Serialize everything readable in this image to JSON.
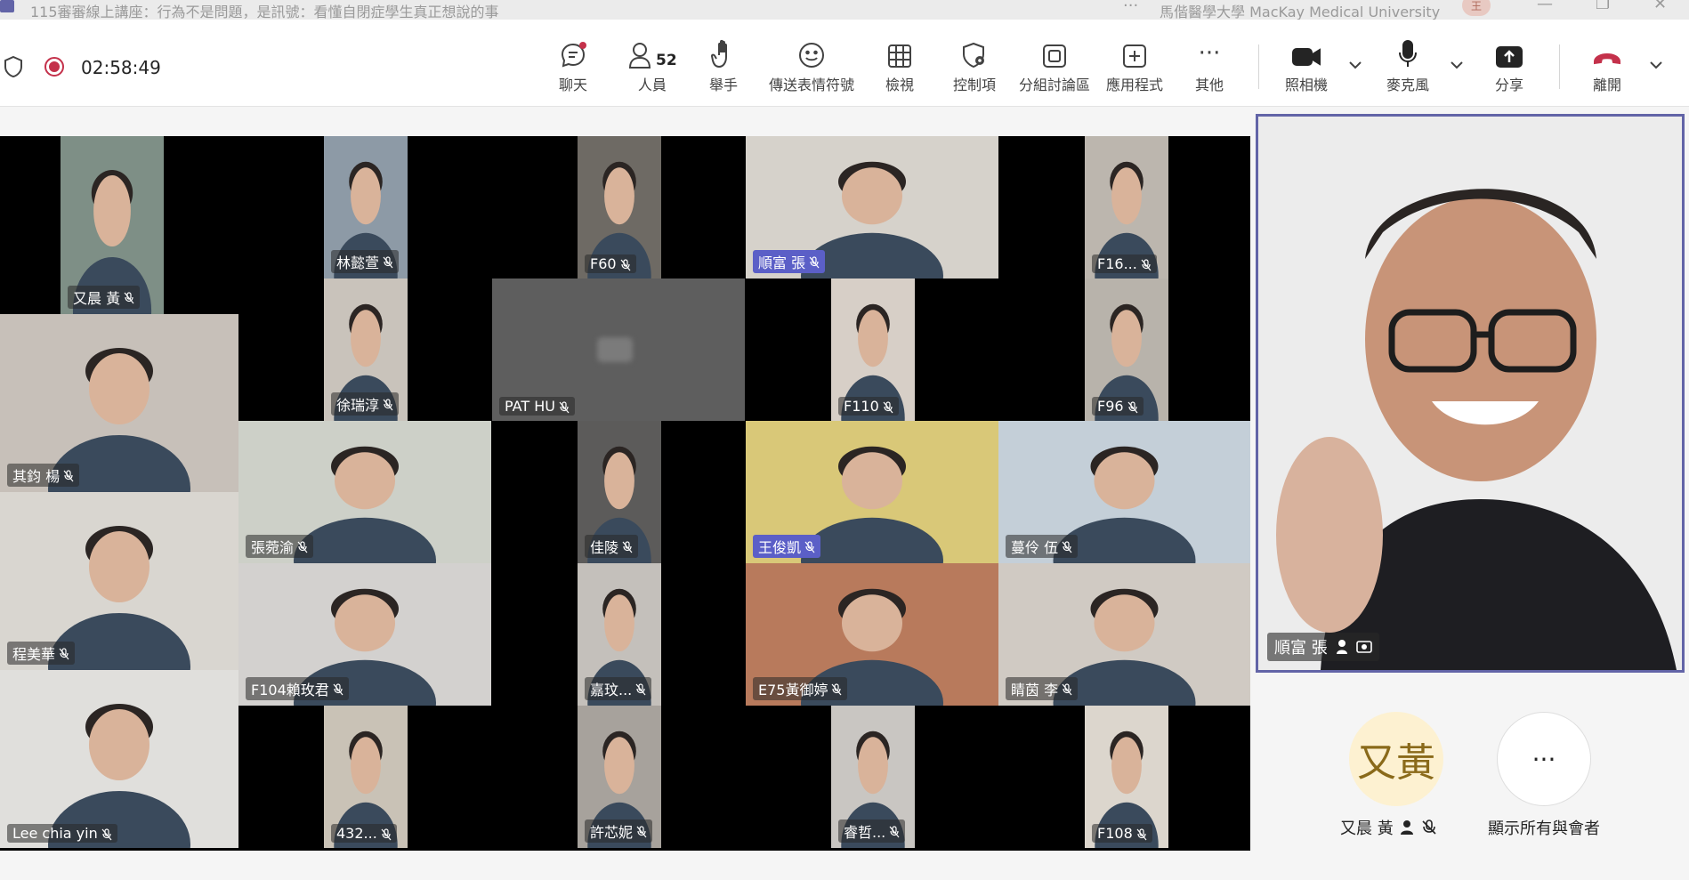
{
  "titlebar": {
    "title": "115審審線上講座：行為不是問題，是訊號：看懂自閉症學生真正想說的事",
    "more": "···",
    "org": "馬偕醫學大學 MacKay Medical University",
    "avatar": "王",
    "minimize": "—",
    "restore": "❐",
    "close": "✕"
  },
  "toolbar": {
    "timer": "02:58:49",
    "participant_count": "52",
    "chat": "聊天",
    "people": "人員",
    "raise_hand": "舉手",
    "react": "傳送表情符號",
    "view": "檢視",
    "controls": "控制項",
    "breakout": "分組討論區",
    "apps": "應用程式",
    "more": "其他",
    "camera": "照相機",
    "mic": "麥克風",
    "share": "分享",
    "leave": "離開",
    "more_dots": "···"
  },
  "tiles": [
    {
      "name": "又晨 黃",
      "color": "#7e8f86"
    },
    {
      "name": "林懿萱",
      "color": "#8d9aa6"
    },
    {
      "name": "F60",
      "color": "#6e6a64"
    },
    {
      "name": "順富 張",
      "color": "#d6d2cb",
      "highlight": true
    },
    {
      "name": "F16...",
      "color": "#bcb6ae"
    },
    {
      "name": "其鈞 楊",
      "color": "#c7c0b9"
    },
    {
      "name": "徐瑞淳",
      "color": "#c9c3bb"
    },
    {
      "name": "PAT HU",
      "color": "#5e5e5e"
    },
    {
      "name": "F110",
      "color": "#d7cfc7"
    },
    {
      "name": "F96",
      "color": "#b8b3ab"
    },
    {
      "name": "張菀渝",
      "color": "#cdd0c8"
    },
    {
      "name": "佳陵",
      "color": "#5c5b5a"
    },
    {
      "name": "王俊凱",
      "color": "#d9c878",
      "highlight": true
    },
    {
      "name": "蔓伶 伍",
      "color": "#c4cfd8"
    },
    {
      "name": "程美華",
      "color": "#d9d6d0"
    },
    {
      "name": "F104賴玫君",
      "color": "#d3d1cf"
    },
    {
      "name": "嘉玟...",
      "color": "#c4c0bb"
    },
    {
      "name": "E75黃御婷",
      "color": "#b87a5c"
    },
    {
      "name": "睛茵 李",
      "color": "#d0cac3"
    },
    {
      "name": "Lee chia yin",
      "color": "#e0dfdc"
    },
    {
      "name": "432...",
      "color": "#c9c2b6"
    },
    {
      "name": "許芯妮",
      "color": "#a7a29c"
    },
    {
      "name": "睿哲...",
      "color": "#c9c6c2"
    },
    {
      "name": "F108",
      "color": "#dcd6cd"
    }
  ],
  "spotlight": {
    "name": "順富 張",
    "color": "#e6e6e4"
  },
  "side": {
    "avatar_initials": "又黃",
    "avatar_name": "又晨 黃",
    "show_all_label": "顯示所有與會者",
    "dots": "···"
  }
}
